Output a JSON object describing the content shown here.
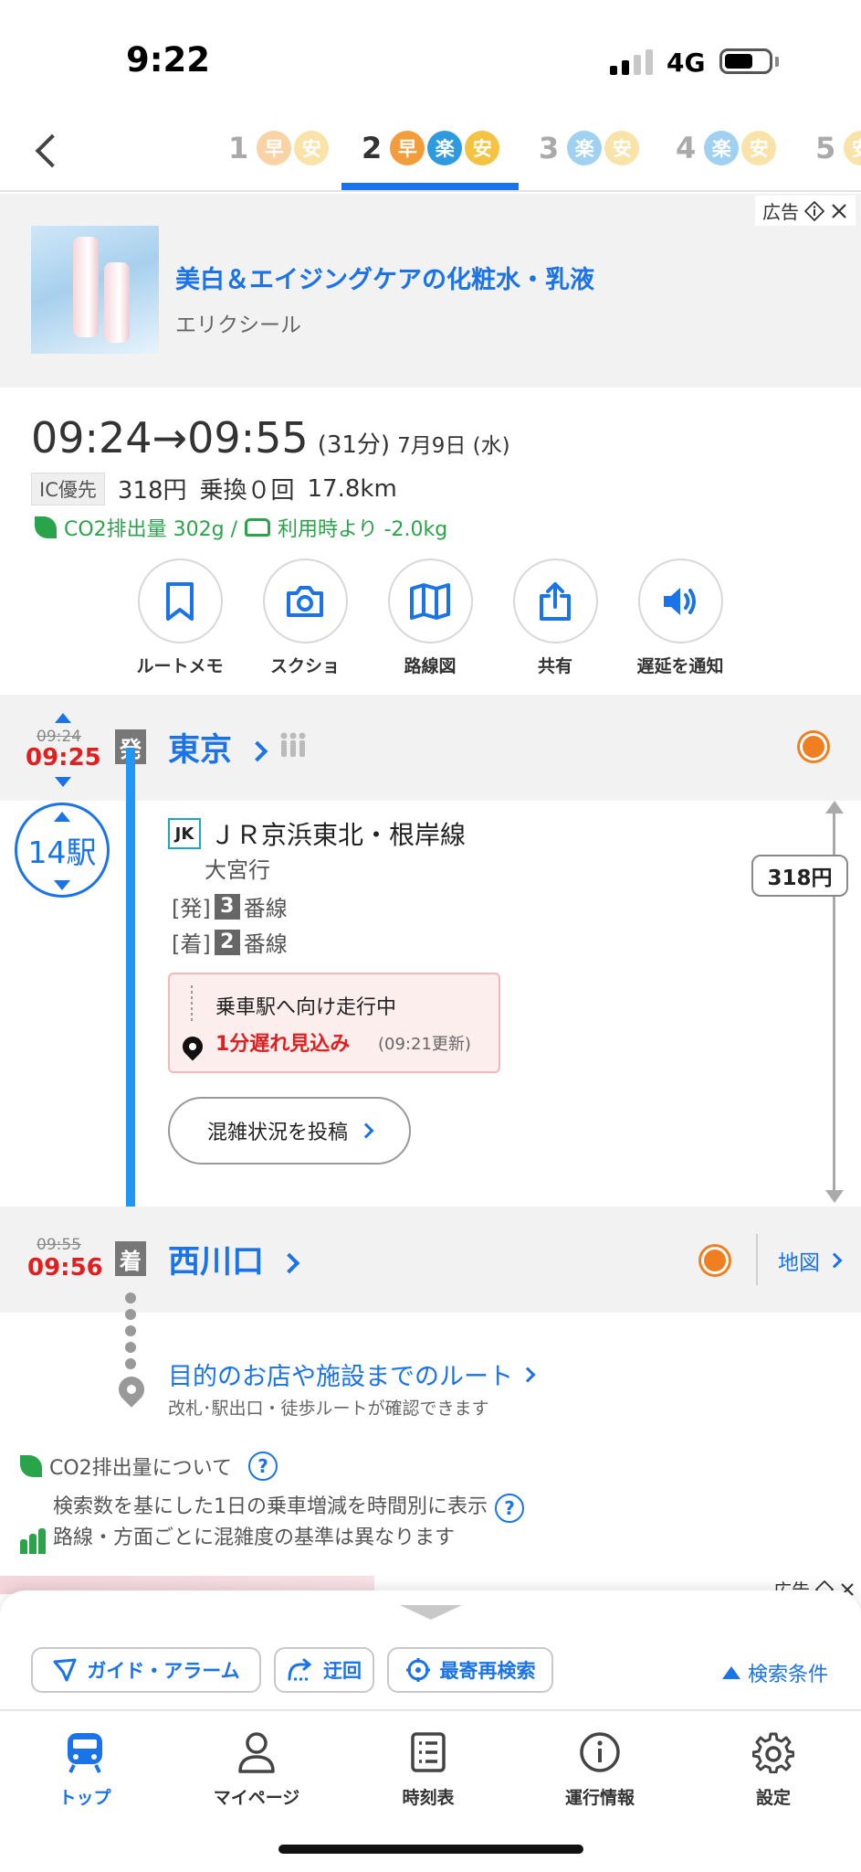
{
  "status_bar": {
    "time": "9:22",
    "network": "4G"
  },
  "route_tabs": {
    "tabs": [
      {
        "num": "1",
        "badges": [
          "早",
          "安"
        ],
        "active": false
      },
      {
        "num": "2",
        "badges": [
          "早",
          "楽",
          "安"
        ],
        "active": true
      },
      {
        "num": "3",
        "badges": [
          "楽",
          "安"
        ],
        "active": false
      },
      {
        "num": "4",
        "badges": [
          "楽",
          "安"
        ],
        "active": false
      },
      {
        "num": "5",
        "badges": [
          "安"
        ],
        "active": false
      }
    ]
  },
  "ad_top": {
    "label": "広告",
    "title": "美白＆エイジングケアの化粧水・乳液",
    "advertiser": "エリクシール"
  },
  "summary": {
    "depart": "09:24",
    "arrow": "→",
    "arrive": "09:55",
    "duration": "(31分)",
    "date": "7月9日 (水)",
    "ic_tag": "IC優先",
    "fare": "318円",
    "transfers": "乗換０回",
    "distance": "17.8km",
    "co2": "CO2排出量 302g /",
    "car_compare": "利用時より -2.0kg"
  },
  "actions": [
    {
      "label": "ルートメモ",
      "icon": "bookmark-icon"
    },
    {
      "label": "スクショ",
      "icon": "camera-icon"
    },
    {
      "label": "路線図",
      "icon": "map-icon"
    },
    {
      "label": "共有",
      "icon": "share-icon"
    },
    {
      "label": "遅延を通知",
      "icon": "speaker-icon"
    }
  ],
  "departure": {
    "time_scheduled": "09:24",
    "time_actual": "09:25",
    "marker": "発",
    "station": "東京"
  },
  "segment": {
    "stations": "14駅",
    "line_code": "JK",
    "line_name": "ＪＲ京浜東北・根岸線",
    "destination": "大宮行",
    "dep_track_prefix": "[発]",
    "dep_track_num": "3",
    "track_suffix": "番線",
    "arr_track_prefix": "[着]",
    "arr_track_num": "2",
    "delay_status": "乗車駅へ向け走行中",
    "delay_msg": "1分遅れ見込み",
    "delay_updated": "(09:21更新)",
    "congestion_btn": "混雑状況を投稿",
    "fare_side": "318円"
  },
  "arrival": {
    "time_scheduled": "09:55",
    "time_actual": "09:56",
    "marker": "着",
    "station": "西川口",
    "map_link": "地図"
  },
  "dest_route": {
    "title": "目的のお店や施設までのルート",
    "subtitle": "改札･駅出口・徒歩ルートが確認できます"
  },
  "info": {
    "co2_about": "CO2排出量について",
    "congestion_line1": "検索数を基にした1日の乗車増減を時間別に表示",
    "congestion_line2": "路線・方面ごとに混雑度の基準は異なります",
    "q_mark": "?"
  },
  "ad_bottom": {
    "label": "広告"
  },
  "bottom_sheet": {
    "guide_alarm": "ガイド・アラーム",
    "detour": "迂回",
    "nearest": "最寄再検索",
    "search_conditions": "検索条件"
  },
  "tabbar": [
    {
      "label": "トップ",
      "active": true
    },
    {
      "label": "マイページ",
      "active": false
    },
    {
      "label": "時刻表",
      "active": false
    },
    {
      "label": "運行情報",
      "active": false
    },
    {
      "label": "設定",
      "active": false
    }
  ],
  "colors": {
    "accent": "#1a73e8",
    "delay_red": "#e02020",
    "eco_green": "#2aa44a",
    "route_blue": "#2196f3"
  }
}
